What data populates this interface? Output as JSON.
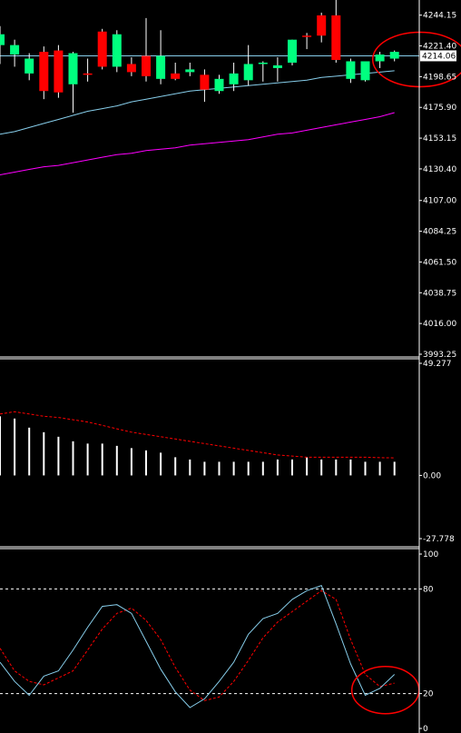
{
  "colors": {
    "background": "#000000",
    "separator": "#ffffff",
    "bull_candle": "#00ff7f",
    "bear_candle": "#ff0000",
    "wick": "#ffffff",
    "ma_fast": "#87ceeb",
    "ma_slow": "#ff00ff",
    "current_price_line": "#87ceeb",
    "histogram": "#ffffff",
    "signal_line": "#ff0000",
    "stoch_main": "#87ceeb",
    "stoch_signal": "#ff0000",
    "level_line": "#ffffff",
    "annotation": "#ff0000",
    "price_badge_bg": "#ffffff",
    "price_badge_text": "#000000"
  },
  "chart_data": [
    {
      "id": "price",
      "type": "candlestick",
      "y_ticks": [
        "4244.15",
        "4221.40",
        "4198.65",
        "4175.90",
        "4153.15",
        "4130.40",
        "4107.00",
        "4084.25",
        "4061.50",
        "4038.75",
        "4016.00",
        "3993.25"
      ],
      "ylim": [
        3993.25,
        4252
      ],
      "current_price": 4214.06,
      "current_price_label": "4214.06",
      "candles": [
        {
          "o": 4222,
          "h": 4236,
          "l": 4208,
          "c": 4230
        },
        {
          "o": 4215,
          "h": 4226,
          "l": 4206,
          "c": 4222
        },
        {
          "o": 4201,
          "h": 4216,
          "l": 4196,
          "c": 4212
        },
        {
          "o": 4217,
          "h": 4221,
          "l": 4182,
          "c": 4188
        },
        {
          "o": 4218,
          "h": 4222,
          "l": 4183,
          "c": 4187
        },
        {
          "o": 4193,
          "h": 4217,
          "l": 4172,
          "c": 4216
        },
        {
          "o": 4201,
          "h": 4212,
          "l": 4195,
          "c": 4200
        },
        {
          "o": 4232,
          "h": 4234,
          "l": 4204,
          "c": 4206
        },
        {
          "o": 4206,
          "h": 4233,
          "l": 4202,
          "c": 4230
        },
        {
          "o": 4208,
          "h": 4213,
          "l": 4199,
          "c": 4202
        },
        {
          "o": 4214,
          "h": 4242,
          "l": 4195,
          "c": 4199
        },
        {
          "o": 4197,
          "h": 4233,
          "l": 4193,
          "c": 4214
        },
        {
          "o": 4201,
          "h": 4209,
          "l": 4196,
          "c": 4197
        },
        {
          "o": 4202,
          "h": 4209,
          "l": 4199,
          "c": 4204
        },
        {
          "o": 4200,
          "h": 4204,
          "l": 4180,
          "c": 4189
        },
        {
          "o": 4188,
          "h": 4200,
          "l": 4186,
          "c": 4197
        },
        {
          "o": 4193,
          "h": 4209,
          "l": 4188,
          "c": 4201
        },
        {
          "o": 4196,
          "h": 4222,
          "l": 4192,
          "c": 4208
        },
        {
          "o": 4208,
          "h": 4210,
          "l": 4195,
          "c": 4209
        },
        {
          "o": 4205,
          "h": 4213,
          "l": 4195,
          "c": 4207
        },
        {
          "o": 4209,
          "h": 4226,
          "l": 4207,
          "c": 4226
        },
        {
          "o": 4229,
          "h": 4231,
          "l": 4219,
          "c": 4228
        },
        {
          "o": 4244,
          "h": 4246,
          "l": 4224,
          "c": 4229
        },
        {
          "o": 4244,
          "h": 4256,
          "l": 4209,
          "c": 4211
        },
        {
          "o": 4197,
          "h": 4212,
          "l": 4194,
          "c": 4210
        },
        {
          "o": 4196,
          "h": 4210,
          "l": 4195,
          "c": 4210
        },
        {
          "o": 4210,
          "h": 4217,
          "l": 4205,
          "c": 4215
        },
        {
          "o": 4212,
          "h": 4218,
          "l": 4210,
          "c": 4217
        }
      ],
      "ma_fast": [
        4156,
        4158,
        4161,
        4164,
        4167,
        4170,
        4173,
        4175,
        4177,
        4180,
        4182,
        4184,
        4186,
        4188,
        4189,
        4190,
        4191,
        4192,
        4193,
        4194,
        4195,
        4196,
        4198,
        4199,
        4200,
        4201,
        4202,
        4203
      ],
      "ma_slow": [
        4126,
        4128,
        4130,
        4132,
        4133,
        4135,
        4137,
        4139,
        4141,
        4142,
        4144,
        4145,
        4146,
        4148,
        4149,
        4150,
        4151,
        4152,
        4154,
        4156,
        4157,
        4159,
        4161,
        4163,
        4165,
        4167,
        4169,
        4172
      ],
      "annotation": {
        "type": "ellipse",
        "around": "last-candles"
      }
    },
    {
      "id": "histogram",
      "type": "bar",
      "y_ticks": [
        "49.277",
        "0.00",
        "-27.778"
      ],
      "ylim": [
        -27.778,
        49.277
      ],
      "values": [
        26,
        25,
        21,
        19,
        17,
        15,
        14,
        14,
        13,
        12,
        11,
        10,
        8,
        7,
        6,
        6,
        6,
        6,
        6,
        7,
        7,
        8,
        7,
        7,
        7,
        6,
        6,
        6
      ],
      "signal": [
        27,
        28,
        27,
        26,
        25.5,
        24.5,
        23.5,
        22,
        20.5,
        19,
        18,
        17,
        16,
        15,
        14,
        13,
        12,
        11,
        10,
        9,
        8.5,
        8,
        8,
        8,
        8,
        8,
        7.8,
        7.7
      ]
    },
    {
      "id": "stochastic",
      "type": "line",
      "y_ticks": [
        "100",
        "80",
        "20",
        "0"
      ],
      "ylim": [
        0,
        100
      ],
      "levels": [
        80,
        20
      ],
      "main": [
        38,
        27,
        19,
        30,
        33,
        45,
        58,
        70,
        71,
        66,
        50,
        34,
        21,
        12,
        17,
        27,
        38,
        54,
        63,
        66,
        74,
        79,
        82,
        60,
        37,
        19,
        23,
        31
      ],
      "signal": [
        46,
        33,
        27,
        25,
        29,
        33,
        45,
        57,
        66,
        69,
        62,
        51,
        35,
        22,
        16,
        18,
        27,
        39,
        52,
        61,
        67,
        73,
        79,
        74,
        51,
        31,
        24,
        26
      ],
      "annotation": {
        "type": "ellipse",
        "around": "last-points"
      }
    }
  ]
}
